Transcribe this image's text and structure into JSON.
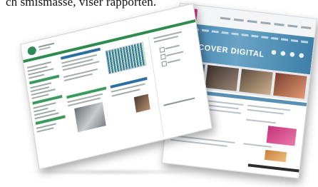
{
  "caption": {
    "text": "ch smismasse, viser rapporten."
  },
  "right_page": {
    "hero_title": "DISCOVER DIGITAL",
    "colors": {
      "logo": "#e8288c",
      "hero": "#4b8fb8",
      "accent": "#5a8fb4",
      "promo": "#c8327a"
    }
  },
  "left_page": {
    "colors": {
      "logo": "#2e8b57",
      "navbar": "#2d8b4e",
      "section_header": "#2d6fa0"
    }
  }
}
